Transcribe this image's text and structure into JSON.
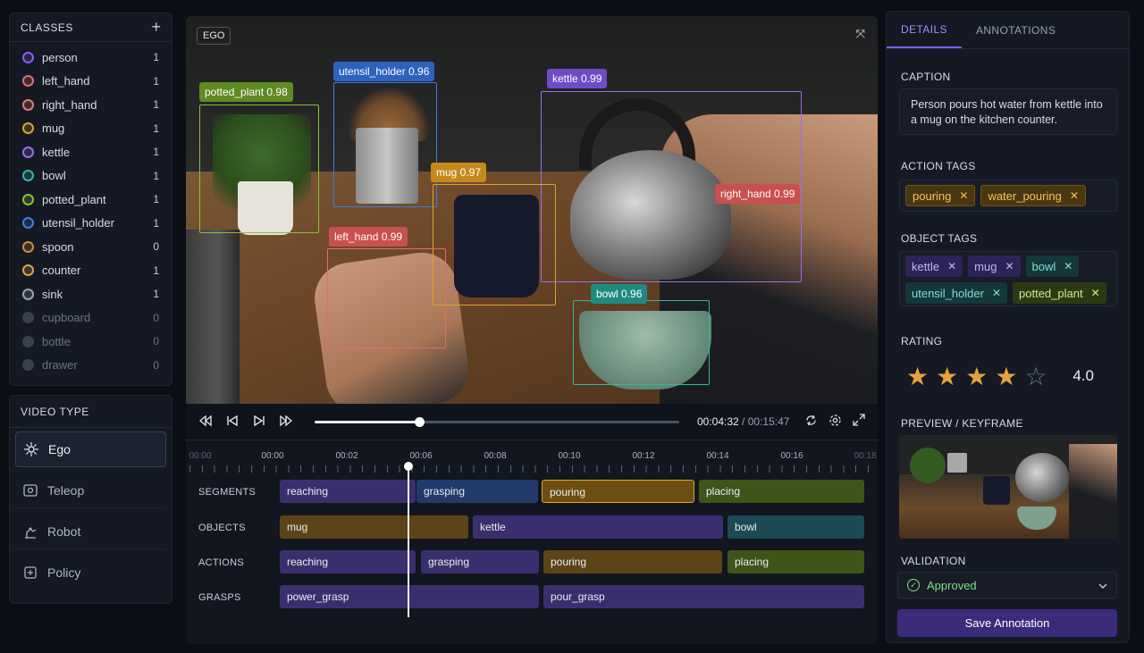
{
  "colors": {
    "person": "#8b5cf6",
    "left_hand": "#e26d6d",
    "right_hand": "#e07a7a",
    "mug": "#e0a231",
    "kettle": "#9b6ee8",
    "bowl": "#2fb6a8",
    "potted_plant": "#8bbf3b",
    "utensil_holder": "#3f7ee0",
    "spoon": "#d28a34",
    "counter": "#d9a545",
    "sink": "#9aa3b4",
    "accent": "#7c5cf0"
  },
  "classes_panel": {
    "title": "CLASSES",
    "add_label": "+",
    "items": [
      {
        "name": "person",
        "count": "1",
        "color": "#8b5cf6"
      },
      {
        "name": "left_hand",
        "count": "1",
        "color": "#e26d6d"
      },
      {
        "name": "right_hand",
        "count": "1",
        "color": "#e07a7a"
      },
      {
        "name": "mug",
        "count": "1",
        "color": "#e0a231"
      },
      {
        "name": "kettle",
        "count": "1",
        "color": "#9b6ee8"
      },
      {
        "name": "bowl",
        "count": "1",
        "color": "#2fb6a8"
      },
      {
        "name": "potted_plant",
        "count": "1",
        "color": "#8bbf3b"
      },
      {
        "name": "utensil_holder",
        "count": "1",
        "color": "#3f7ee0"
      },
      {
        "name": "spoon",
        "count": "0",
        "color": "#d28a34"
      },
      {
        "name": "counter",
        "count": "1",
        "color": "#d9a545"
      },
      {
        "name": "sink",
        "count": "1",
        "color": "#9aa3b4"
      },
      {
        "name": "cupboard",
        "count": "0",
        "color": "#3a404c"
      },
      {
        "name": "bottle",
        "count": "0",
        "color": "#3a404c"
      },
      {
        "name": "drawer",
        "count": "0",
        "color": "#3a404c"
      }
    ]
  },
  "video_type": {
    "title": "VIDEO TYPE",
    "items": [
      {
        "label": "Ego",
        "icon": "ego-icon"
      },
      {
        "label": "Teleop",
        "icon": "teleop-icon"
      },
      {
        "label": "Robot",
        "icon": "robot-icon"
      },
      {
        "label": "Policy",
        "icon": "policy-icon"
      }
    ],
    "selected": "Ego"
  },
  "video": {
    "badge": "EGO",
    "detections": [
      {
        "label": "potted_plant 0.98",
        "color": "#8bbf3b"
      },
      {
        "label": "utensil_holder 0.96",
        "color": "#3f7ee0"
      },
      {
        "label": "kettle 0.99",
        "color": "#9b6ee8"
      },
      {
        "label": "mug 0.97",
        "color": "#e0a231"
      },
      {
        "label": "right_hand 0.99",
        "color": "#e26d6d"
      },
      {
        "label": "left_hand 0.99",
        "color": "#e26d6d"
      },
      {
        "label": "bowl 0.96",
        "color": "#2fb6a8"
      }
    ]
  },
  "playback": {
    "current_time": "00:04:32",
    "separator": " / ",
    "total_time": "00:15:47",
    "progress": 0.287
  },
  "timeline": {
    "ticks": [
      "00:00",
      "00:00",
      "00:02",
      "00:06",
      "00:08",
      "00:10",
      "00:12",
      "00:14",
      "00:16",
      "00:18"
    ],
    "tracks": [
      {
        "label": "SEGMENTS",
        "segments": [
          {
            "text": "reaching",
            "color": "#3a2f6e"
          },
          {
            "text": "grasping",
            "color": "#213a6a"
          },
          {
            "text": "pouring",
            "color": "#6e4d12",
            "border": "#e0a231"
          },
          {
            "text": "placing",
            "color": "#3f5419"
          }
        ]
      },
      {
        "label": "OBJECTS",
        "segments": [
          {
            "text": "mug",
            "color": "#5c4418"
          },
          {
            "text": "kettle",
            "color": "#3a2f6e"
          },
          {
            "text": "bowl",
            "color": "#1b4a52"
          }
        ]
      },
      {
        "label": "ACTIONS",
        "segments": [
          {
            "text": "reaching",
            "color": "#3a2f6e"
          },
          {
            "text": "grasping",
            "color": "#3a2f6e"
          },
          {
            "text": "pouring",
            "color": "#5c4418"
          },
          {
            "text": "placing",
            "color": "#3f5419"
          }
        ]
      },
      {
        "label": "GRASPS",
        "segments": [
          {
            "text": "power_grasp",
            "color": "#3a2f6e"
          },
          {
            "text": "pour_grasp",
            "color": "#3a2f6e"
          }
        ]
      }
    ]
  },
  "details": {
    "tabs": [
      "DETAILS",
      "ANNOTATIONS"
    ],
    "active_tab": "DETAILS",
    "caption_title": "CAPTION",
    "caption": "Person pours hot water from kettle into a mug on the kitchen counter.",
    "action_tags_title": "ACTION TAGS",
    "action_tags": [
      "pouring",
      "water_pouring"
    ],
    "object_tags_title": "OBJECT TAGS",
    "object_tags": [
      {
        "text": "kettle",
        "bg": "#2c2456",
        "fg": "#c4b5fd"
      },
      {
        "text": "mug",
        "bg": "#2c2456",
        "fg": "#c4b5fd"
      },
      {
        "text": "bowl",
        "bg": "#14373a",
        "fg": "#7ee0d4"
      },
      {
        "text": "utensil_holder",
        "bg": "#14373a",
        "fg": "#7ee0d4"
      },
      {
        "text": "potted_plant",
        "bg": "#2c3a14",
        "fg": "#d4e88c"
      }
    ],
    "rating_title": "RATING",
    "rating": 4,
    "rating_max": 5,
    "rating_value": "4.0",
    "preview_title": "PREVIEW / KEYFRAME",
    "validation_title": "VALIDATION",
    "validation_status": "Approved",
    "save_label": "Save Annotation"
  }
}
